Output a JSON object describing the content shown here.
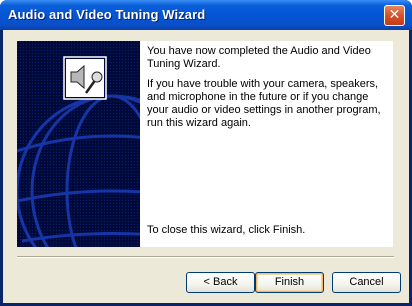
{
  "window": {
    "title": "Audio and Video Tuning Wizard",
    "close_glyph": "✕",
    "close_icon": "close-icon"
  },
  "content": {
    "paragraph_1": "You have now completed the Audio and Video Tuning Wizard.",
    "paragraph_2": "If you have trouble with your camera, speakers, and microphone in the future or if you change your audio or video settings in another program, run this wizard again.",
    "paragraph_3": "To close this wizard, click Finish."
  },
  "side_panel": {
    "icon": "speaker-microphone-icon",
    "background": "globe-graphic"
  },
  "buttons": {
    "back_label": "< Back",
    "finish_label": "Finish",
    "cancel_label": "Cancel"
  },
  "colors": {
    "titlebar": "#0455d6",
    "dialog_face": "#ece9d8",
    "side_panel": "#000a3a",
    "close_button": "#d6512a"
  }
}
